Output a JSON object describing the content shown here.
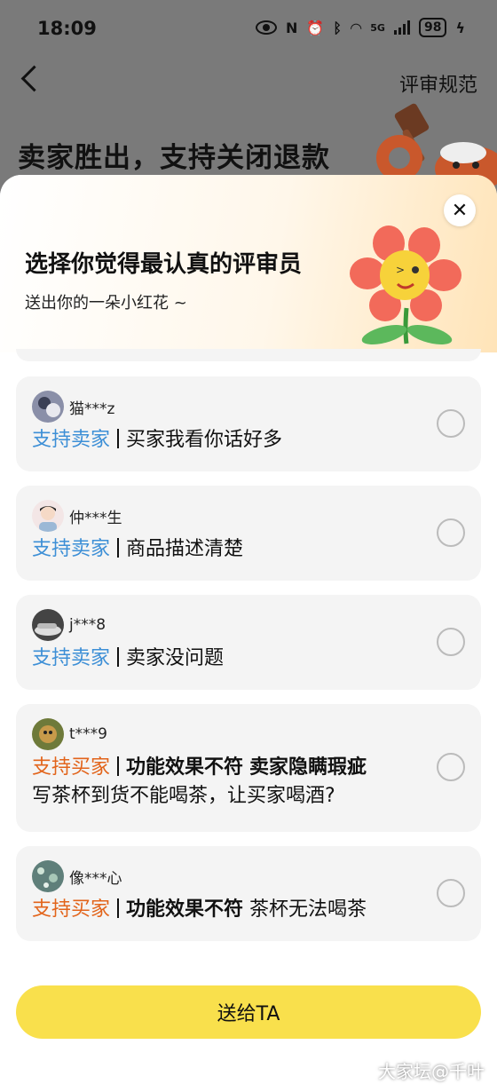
{
  "status_bar": {
    "time": "18:09",
    "battery": "98",
    "network": "5G"
  },
  "header": {
    "rules_link": "评审规范",
    "verdict_title": "卖家胜出，支持关闭退款"
  },
  "sheet": {
    "title": "选择你觉得最认真的评审员",
    "subtitle": "送出你的一朵小红花 ~",
    "close_symbol": "✕"
  },
  "reviewers": [
    {
      "name": "猫***z",
      "stance": "支持卖家",
      "stance_type": "seller",
      "reason_tags": [],
      "comment": "买家我看你话好多"
    },
    {
      "name": "仲***生",
      "stance": "支持卖家",
      "stance_type": "seller",
      "reason_tags": [],
      "comment": "商品描述清楚"
    },
    {
      "name": "j***8",
      "stance": "支持卖家",
      "stance_type": "seller",
      "reason_tags": [],
      "comment": "卖家没问题"
    },
    {
      "name": "t***9",
      "stance": "支持买家",
      "stance_type": "buyer",
      "reason_tags": [
        "功能效果不符",
        "卖家隐瞒瑕疵"
      ],
      "comment": "写茶杯到货不能喝茶，让买家喝酒?"
    },
    {
      "name": "像***心",
      "stance": "支持买家",
      "stance_type": "buyer",
      "reason_tags": [
        "功能效果不符"
      ],
      "comment": "茶杯无法喝茶"
    }
  ],
  "send_button": "送给TA",
  "watermark": "大家坛@千叶",
  "colors": {
    "seller": "#3d8fd6",
    "buyer": "#e2641b",
    "button": "#f9e04c"
  }
}
